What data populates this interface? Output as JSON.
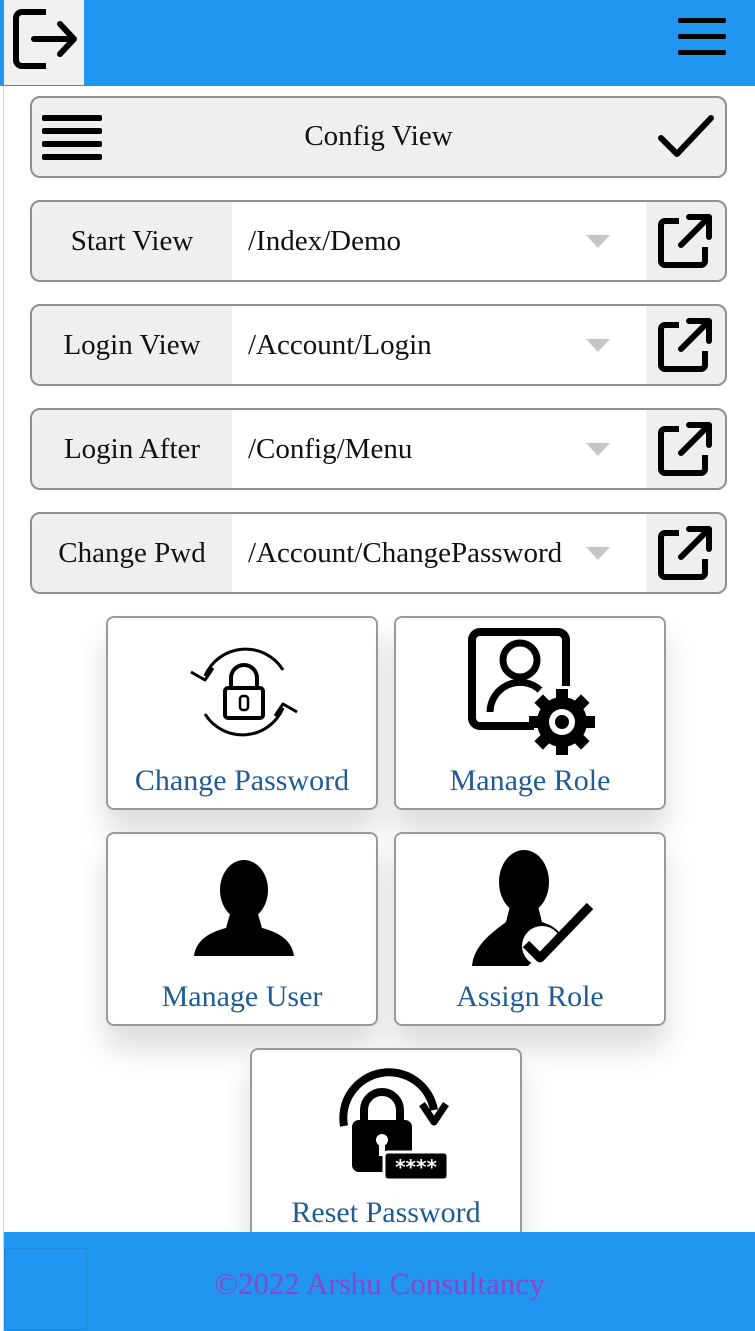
{
  "header": {
    "logout_icon": "logout-icon",
    "menu_icon": "hamburger-icon"
  },
  "config_card": {
    "title": "Config View",
    "menu_icon": "hamburger-icon",
    "confirm_icon": "checkmark-icon"
  },
  "rows": [
    {
      "label": "Start View",
      "value": "/Index/Demo"
    },
    {
      "label": "Login View",
      "value": "/Account/Login"
    },
    {
      "label": "Login After",
      "value": "/Config/Menu"
    },
    {
      "label": "Change Pwd",
      "value": "/Account/ChangePassword"
    }
  ],
  "tiles": [
    {
      "label": "Change Password",
      "icon": "lock-cycle-icon"
    },
    {
      "label": "Manage Role",
      "icon": "user-gear-icon"
    },
    {
      "label": "Manage User",
      "icon": "user-icon"
    },
    {
      "label": "Assign Role",
      "icon": "user-check-icon"
    },
    {
      "label": "Reset Password",
      "icon": "lock-reset-icon"
    }
  ],
  "footer": {
    "text": "©2022 Arshu Consultancy"
  },
  "colors": {
    "primary": "#2196f0",
    "tile_text": "#1e5c93",
    "footer_text": "#8e44c9"
  }
}
